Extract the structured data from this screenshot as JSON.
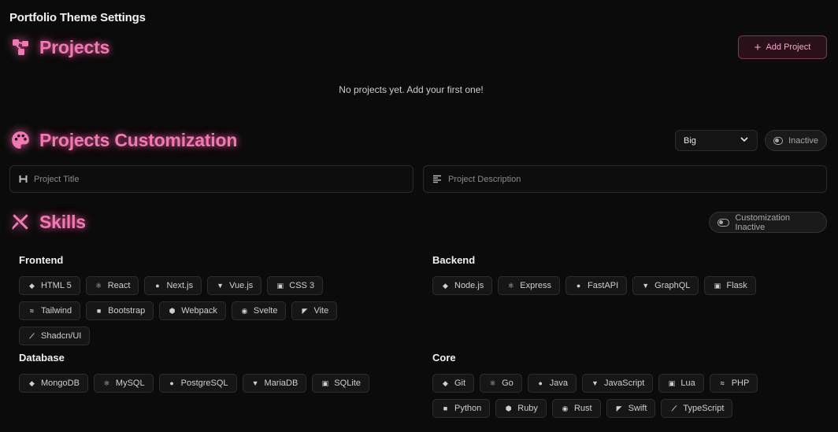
{
  "app_title": "Portfolio Theme Settings",
  "accent": "#f277b4",
  "projects": {
    "title": "Projects",
    "add_label": "Add Project",
    "empty_text": "No projects yet. Add your first one!"
  },
  "customization": {
    "title": "Projects Customization",
    "size_value": "Big",
    "status_label": "Inactive",
    "title_placeholder": "Project Title",
    "description_placeholder": "Project Description"
  },
  "skills": {
    "title": "Skills",
    "status_label": "Customization Inactive",
    "frontend": {
      "title": "Frontend",
      "items": [
        "HTML 5",
        "React",
        "Next.js",
        "Vue.js",
        "CSS 3",
        "Tailwind",
        "Bootstrap",
        "Webpack",
        "Svelte",
        "Vite",
        "Shadcn/UI"
      ]
    },
    "backend": {
      "title": "Backend",
      "items": [
        "Node.js",
        "Express",
        "FastAPI",
        "GraphQL",
        "Flask"
      ]
    },
    "database": {
      "title": "Database",
      "items": [
        "MongoDB",
        "MySQL",
        "PostgreSQL",
        "MariaDB",
        "SQLite"
      ]
    },
    "core": {
      "title": "Core",
      "items": [
        "Git",
        "Go",
        "Java",
        "JavaScript",
        "Lua",
        "PHP",
        "Python",
        "Ruby",
        "Rust",
        "Swift",
        "TypeScript"
      ]
    }
  }
}
